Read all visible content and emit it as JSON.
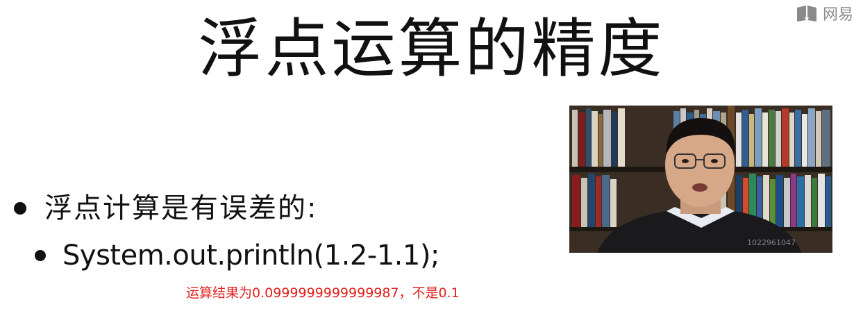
{
  "slide": {
    "title": "浮点运算的精度",
    "bullets": [
      {
        "text": "浮点计算是有误差的:"
      },
      {
        "text": "System.out.println(1.2-1.1);"
      }
    ],
    "annotation": "运算结果为0.0999999999999987，不是0.1"
  },
  "brand": {
    "text": "网易",
    "icon": "book-icon",
    "color": "#8a8a8a"
  },
  "video": {
    "watermark": "1022961047"
  },
  "colors": {
    "annotation": "#e0201c",
    "text": "#111111"
  }
}
